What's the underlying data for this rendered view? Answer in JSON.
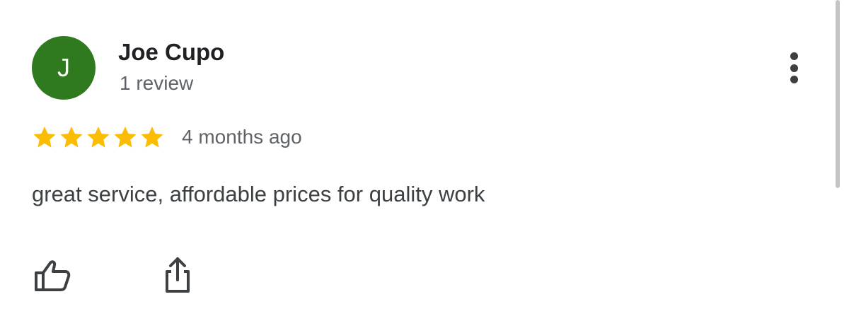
{
  "reviewer": {
    "avatar_initial": "J",
    "name": "Joe Cupo",
    "review_count": "1 review"
  },
  "review": {
    "rating": 5,
    "rating_max": 5,
    "date": "4 months ago",
    "text": "great service, affordable prices for quality work"
  },
  "actions": {
    "like_icon": "thumbs-up-icon",
    "share_icon": "share-icon",
    "more_icon": "more-vert-icon"
  },
  "colors": {
    "avatar_bg": "#2f7a1f",
    "star": "#fbbc04",
    "primary_text": "#202124",
    "secondary_text": "#5f6368"
  }
}
